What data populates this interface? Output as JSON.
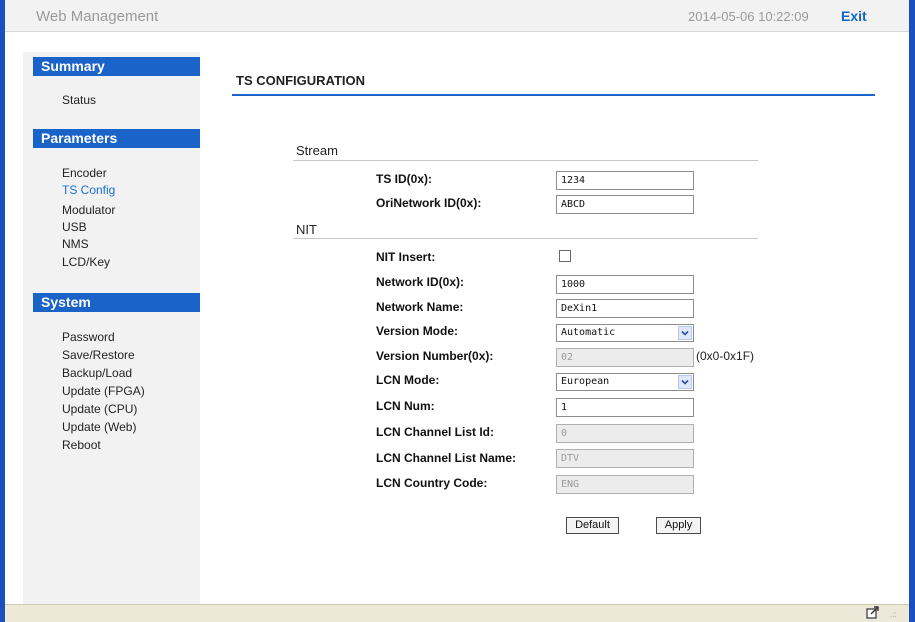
{
  "header": {
    "title": "Web Management",
    "datetime": "2014-05-06 10:22:09",
    "exit_label": "Exit"
  },
  "sidebar": {
    "sections": [
      {
        "title": "Summary",
        "items": [
          "Status"
        ]
      },
      {
        "title": "Parameters",
        "items": [
          "Encoder",
          "TS Config",
          "Modulator",
          "USB",
          "NMS",
          "LCD/Key"
        ]
      },
      {
        "title": "System",
        "items": [
          "Password",
          "Save/Restore",
          "Backup/Load",
          "Update (FPGA)",
          "Update (CPU)",
          "Update (Web)",
          "Reboot"
        ]
      }
    ],
    "active_item": "TS Config"
  },
  "main": {
    "title": "TS CONFIGURATION",
    "stream": {
      "title": "Stream",
      "ts_id_label": "TS ID(0x):",
      "ts_id_value": "1234",
      "ori_network_id_label": "OriNetwork ID(0x):",
      "ori_network_id_value": "ABCD"
    },
    "nit": {
      "title": "NIT",
      "nit_insert_label": "NIT Insert:",
      "nit_insert_checked": false,
      "network_id_label": "Network ID(0x):",
      "network_id_value": "1000",
      "network_name_label": "Network Name:",
      "network_name_value": "DeXin1",
      "version_mode_label": "Version Mode:",
      "version_mode_value": "Automatic",
      "version_number_label": "Version Number(0x):",
      "version_number_value": "02",
      "version_number_hint": "(0x0-0x1F)",
      "lcn_mode_label": "LCN Mode:",
      "lcn_mode_value": "European",
      "lcn_num_label": "LCN Num:",
      "lcn_num_value": "1",
      "lcn_channel_list_id_label": "LCN Channel List Id:",
      "lcn_channel_list_id_value": "0",
      "lcn_channel_list_name_label": "LCN Channel List Name:",
      "lcn_channel_list_name_value": "DTV",
      "lcn_country_code_label": "LCN Country Code:",
      "lcn_country_code_value": "ENG"
    },
    "buttons": {
      "default_label": "Default",
      "apply_label": "Apply"
    }
  },
  "icons": {
    "footer_icon": "export-page-icon",
    "dropdown_icon": "chevron-down-icon",
    "resize_icon": "resize-grip-icon"
  },
  "colors": {
    "accent": "#1a63c8",
    "active_link": "#1a6fd6",
    "exit_link": "#1464c8"
  }
}
